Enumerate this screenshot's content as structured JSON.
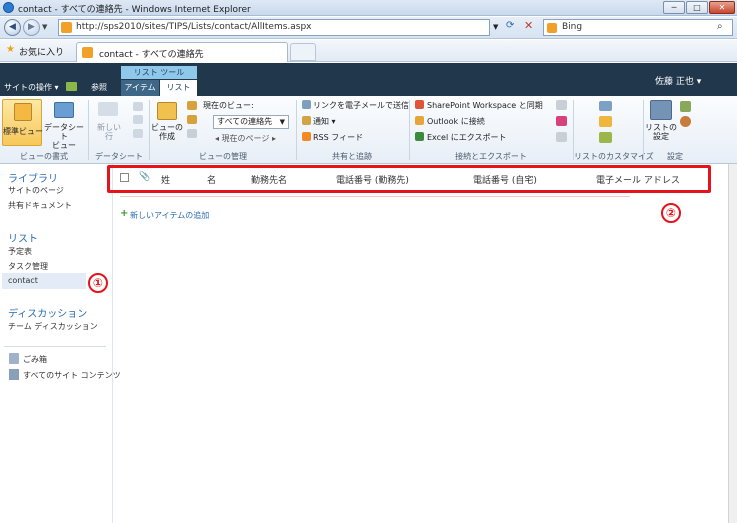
{
  "window": {
    "title": "contact - すべての連絡先 - Windows Internet Explorer",
    "min_glyph": "─",
    "max_glyph": "□",
    "close_glyph": "✕"
  },
  "addressbar": {
    "url": "http://sps2010/sites/TIPS/Lists/contact/AllItems.aspx",
    "search_provider": "Bing"
  },
  "favorites": {
    "label": "お気に入り",
    "active_tab": "contact - すべての連絡先"
  },
  "sp_header": {
    "site_actions": "サイトの操作 ▾",
    "browse": "参照",
    "list_tools": "リスト ツール",
    "tab_item": "アイテム",
    "tab_list": "リスト",
    "user": "佐藤 正也 ▾"
  },
  "ribbon": {
    "std_view": "標準ビュー",
    "ds_view": "データシート\nビュー",
    "new_row": "新しい行",
    "create_view": "ビューの\n作成",
    "current_view_label": "現在のビュー:",
    "current_view_value": "すべての連絡先",
    "current_page": "◂  現在のページ  ▸",
    "email_link": "リンクを電子メールで送信",
    "alert": "通知 ▾",
    "rss": "RSS フィード",
    "sp_workspace": "SharePoint Workspace と同期",
    "outlook": "Outlook に接続",
    "excel": "Excel にエクスポート",
    "list_settings": "リストの\n設定",
    "groups": {
      "view_format": "ビューの書式",
      "datasheet": "データシート",
      "manage_views": "ビューの管理",
      "share_track": "共有と追跡",
      "connect_export": "接続とエクスポート",
      "customize_list": "リストのカスタマイズ",
      "settings": "設定"
    }
  },
  "leftnav": {
    "library": "ライブラリ",
    "site_pages": "サイトのページ",
    "shared_docs": "共有ドキュメント",
    "list": "リスト",
    "calendar": "予定表",
    "tasks": "タスク管理",
    "contact": "contact",
    "discussion": "ディスカッション",
    "team_discussion": "チーム ディスカッション",
    "recycle": "ごみ箱",
    "all_content": "すべてのサイト コンテンツ"
  },
  "list": {
    "columns": [
      "姓",
      "名",
      "勤務先名",
      "電話番号 (勤務先)",
      "電話番号 (自宅)",
      "電子メール アドレス"
    ],
    "add_item": "新しいアイテムの追加"
  },
  "callouts": [
    "①",
    "②"
  ],
  "colors": {
    "ribbon_header": "#21374c",
    "highlight": "#e5131c",
    "link": "#2a6bb0"
  }
}
